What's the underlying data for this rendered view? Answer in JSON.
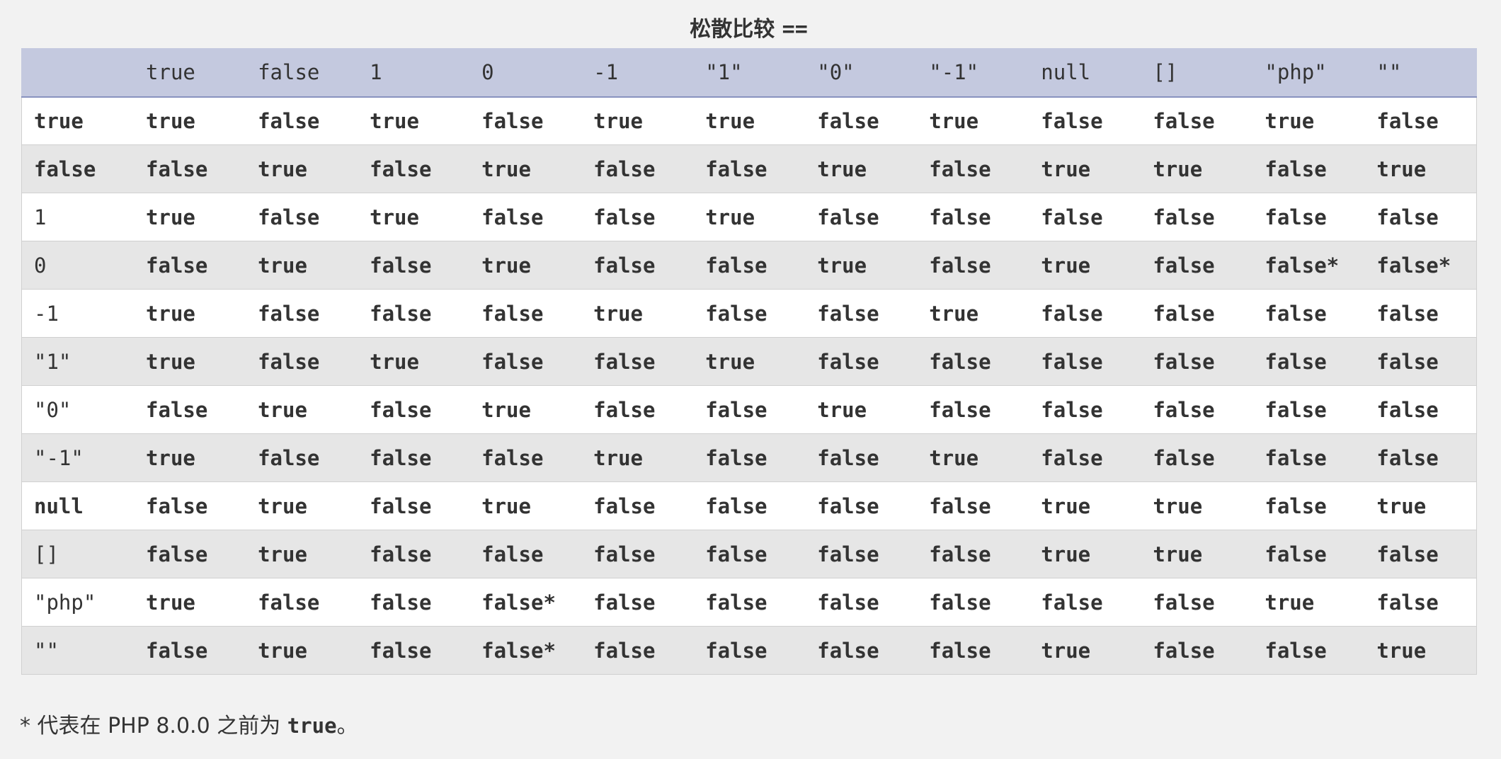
{
  "title": {
    "text": "松散比较",
    "operator": "=="
  },
  "bold_labels": [
    "true",
    "false",
    "null"
  ],
  "columns": [
    "",
    "true",
    "false",
    "1",
    "0",
    "-1",
    "\"1\"",
    "\"0\"",
    "\"-1\"",
    "null",
    "[]",
    "\"php\"",
    "\"\""
  ],
  "rows": [
    {
      "label": "true",
      "values": [
        "true",
        "false",
        "true",
        "false",
        "true",
        "true",
        "false",
        "true",
        "false",
        "false",
        "true",
        "false"
      ]
    },
    {
      "label": "false",
      "values": [
        "false",
        "true",
        "false",
        "true",
        "false",
        "false",
        "true",
        "false",
        "true",
        "true",
        "false",
        "true"
      ]
    },
    {
      "label": "1",
      "values": [
        "true",
        "false",
        "true",
        "false",
        "false",
        "true",
        "false",
        "false",
        "false",
        "false",
        "false",
        "false"
      ]
    },
    {
      "label": "0",
      "values": [
        "false",
        "true",
        "false",
        "true",
        "false",
        "false",
        "true",
        "false",
        "true",
        "false",
        "false*",
        "false*"
      ]
    },
    {
      "label": "-1",
      "values": [
        "true",
        "false",
        "false",
        "false",
        "true",
        "false",
        "false",
        "true",
        "false",
        "false",
        "false",
        "false"
      ]
    },
    {
      "label": "\"1\"",
      "values": [
        "true",
        "false",
        "true",
        "false",
        "false",
        "true",
        "false",
        "false",
        "false",
        "false",
        "false",
        "false"
      ]
    },
    {
      "label": "\"0\"",
      "values": [
        "false",
        "true",
        "false",
        "true",
        "false",
        "false",
        "true",
        "false",
        "false",
        "false",
        "false",
        "false"
      ]
    },
    {
      "label": "\"-1\"",
      "values": [
        "true",
        "false",
        "false",
        "false",
        "true",
        "false",
        "false",
        "true",
        "false",
        "false",
        "false",
        "false"
      ]
    },
    {
      "label": "null",
      "values": [
        "false",
        "true",
        "false",
        "true",
        "false",
        "false",
        "false",
        "false",
        "true",
        "true",
        "false",
        "true"
      ]
    },
    {
      "label": "[]",
      "values": [
        "false",
        "true",
        "false",
        "false",
        "false",
        "false",
        "false",
        "false",
        "true",
        "true",
        "false",
        "false"
      ]
    },
    {
      "label": "\"php\"",
      "values": [
        "true",
        "false",
        "false",
        "false*",
        "false",
        "false",
        "false",
        "false",
        "false",
        "false",
        "true",
        "false"
      ]
    },
    {
      "label": "\"\"",
      "values": [
        "false",
        "true",
        "false",
        "false*",
        "false",
        "false",
        "false",
        "false",
        "true",
        "false",
        "false",
        "true"
      ]
    }
  ],
  "footnote": {
    "prefix": "* 代表在 PHP 8.0.0 之前为 ",
    "keyword": "true",
    "suffix": "。"
  },
  "colors": {
    "background": "#f2f2f2",
    "header_row": "#c4c9df",
    "header_border": "#8892bf",
    "row_odd": "#ffffff",
    "row_even": "#e6e6e6",
    "text": "#333333"
  }
}
